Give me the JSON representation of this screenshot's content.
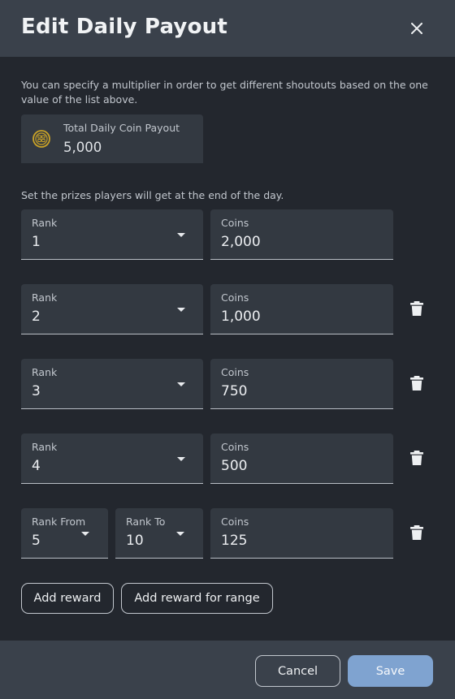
{
  "dialog": {
    "title": "Edit Daily Payout",
    "description": "You can specify a multiplier in order to get different shoutouts based on the one value of the list above.",
    "total_payout": {
      "label": "Total Daily Coin Payout",
      "value": "5,000"
    },
    "prizes_label": "Set the prizes players will get at the end of the day.",
    "rows": [
      {
        "rank_label": "Rank",
        "rank": "1",
        "coins_label": "Coins",
        "coins": "2,000"
      },
      {
        "rank_label": "Rank",
        "rank": "2",
        "coins_label": "Coins",
        "coins": "1,000"
      },
      {
        "rank_label": "Rank",
        "rank": "3",
        "coins_label": "Coins",
        "coins": "750"
      },
      {
        "rank_label": "Rank",
        "rank": "4",
        "coins_label": "Coins",
        "coins": "500"
      }
    ],
    "range_row": {
      "from_label": "Rank From",
      "from": "5",
      "to_label": "Rank To",
      "to": "10",
      "coins_label": "Coins",
      "coins": "125"
    },
    "add_reward_label": "Add reward",
    "add_range_label": "Add reward for range",
    "cancel_label": "Cancel",
    "save_label": "Save"
  },
  "colors": {
    "header_bg": "#3a414b",
    "body_bg": "#23272e",
    "field_bg": "#333941",
    "primary": "#7fa3d0",
    "coin": "#c9a227"
  },
  "icons": [
    "close-icon",
    "coin-icon",
    "dropdown-caret-icon",
    "trash-icon"
  ]
}
